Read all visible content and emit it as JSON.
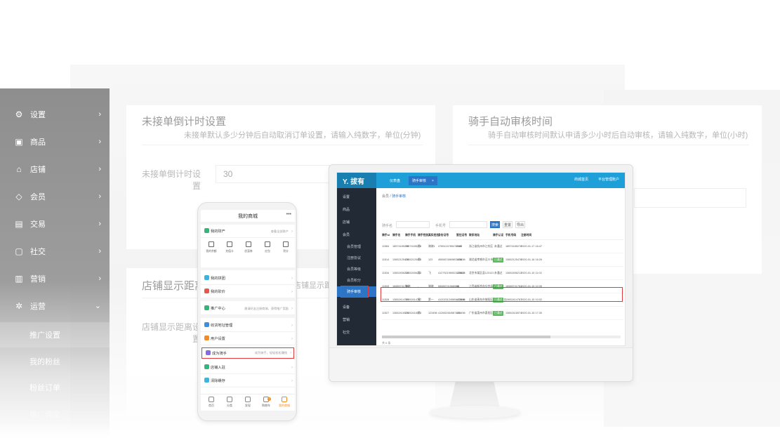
{
  "sidebar": {
    "items": [
      {
        "label": "设置",
        "icon": "gear-icon",
        "glyph": "⚙"
      },
      {
        "label": "商品",
        "icon": "cube-icon",
        "glyph": "▣"
      },
      {
        "label": "店铺",
        "icon": "store-icon",
        "glyph": "⌂"
      },
      {
        "label": "会员",
        "icon": "diamond-icon",
        "glyph": "◇"
      },
      {
        "label": "交易",
        "icon": "ledger-icon",
        "glyph": "▤"
      },
      {
        "label": "社交",
        "icon": "chat-icon",
        "glyph": "▢"
      },
      {
        "label": "营销",
        "icon": "bar-chart-icon",
        "glyph": "▥"
      },
      {
        "label": "运营",
        "icon": "settings-cog-icon",
        "glyph": "✲"
      }
    ],
    "sub_items": [
      "推广设置",
      "我的粉丝",
      "粉丝订单",
      "推广佣金"
    ],
    "active_sub": "推广设置"
  },
  "cards": {
    "countdown": {
      "title": "未接单倒计时设置",
      "desc": "未接单默认多少分钟后自动取消订单设置，请输入纯数字，单位(分钟)",
      "field_label": "未接单倒计时设置",
      "field_value": "30"
    },
    "distance": {
      "title": "店铺显示距离",
      "desc": "店铺显示距离，",
      "field_label": "店铺显示距离设置"
    },
    "rider": {
      "title": "骑手自动审核时间",
      "desc": "骑手自动审核时间默认申请多少小时后自动审核，请输入纯数字，单位(小时)"
    }
  },
  "admin_app": {
    "logo": "Y. 拔有",
    "tabs": [
      "仪表盘",
      "骑手审核"
    ],
    "tab_close": "×",
    "top_right": [
      "商城首页",
      "平台管理账户"
    ],
    "side": [
      "设置",
      "商品",
      "店铺",
      "会员"
    ],
    "side_sub": [
      "会员管理",
      "注册协议",
      "会员等级",
      "会员积分",
      "骑手审核"
    ],
    "side_more": [
      "设备",
      "营销",
      "社交"
    ],
    "breadcrumb_prefix": "会员 /",
    "breadcrumb_current": "骑手审核",
    "filter_labels": [
      "骑手名",
      "手机号"
    ],
    "buttons": [
      "搜索",
      "重置",
      "导出"
    ],
    "columns": [
      "骑手id",
      "骑手名",
      "骑手手机",
      "骑手性别",
      "真实姓名",
      "身份证号",
      "暂住证号",
      "联系地址",
      "骑手认证",
      "手机号码",
      "注册时间"
    ],
    "rows": [
      [
        "11584",
        "18574185278",
        "18574185278",
        "男",
        "骑骑1",
        "4785124785478585",
        "2143",
        "浙江省杭州市江东区",
        "未通过",
        "18574185278",
        "2020-01-17 16:47"
      ],
      [
        "11514",
        "13652125478",
        "13652125478",
        "男",
        "123",
        "4565874569857456",
        "123456",
        "湖北省孝感市汉川市123456",
        "已通过",
        "13652125478",
        "2020-01-16 16:26"
      ],
      [
        "11534",
        "13652456213",
        "13652456213",
        "男",
        "飞",
        "412752196502128812",
        "123456",
        "北京市某区县123121",
        "未通过",
        "13652456213",
        "2020-01-15 11:02"
      ],
      [
        "11533",
        "16585741784",
        "骑骑",
        "-",
        "骑骑",
        "56585741568568",
        "56",
        "江西省新余市分宜县xxx",
        "已通过",
        "16585741784",
        "2020-01-15 10:35"
      ],
      [
        "11528",
        "13652414787",
        "13652414787",
        "男",
        "第一",
        "412023124585412548",
        "123456",
        "山东省青岛市城阳区一二三四五",
        "已通过",
        "13652414787",
        "2020-01-15 10:02"
      ],
      [
        "11527",
        "13652416574",
        "13652416574",
        "男",
        "123456",
        "412652454587456",
        "123456",
        "广东省惠州市惠阳区中心",
        "已通过",
        "13652416574",
        "2020-01-15 17:30"
      ]
    ],
    "footer": "共 6 条"
  },
  "phone_app": {
    "title": "我的商城",
    "dots": "•••",
    "rows": {
      "assets": {
        "label": "我的财产",
        "right": "查看全部财产"
      },
      "groupbuy": {
        "label": "我的拼团"
      },
      "bargain": {
        "label": "我的砍价"
      },
      "promo": {
        "label": "推广中心",
        "right": "邀请好友注册商城，获得推广奖励"
      },
      "address": {
        "label": "收货地址管理"
      },
      "usersettings": {
        "label": "用户设置"
      },
      "rider": {
        "label": "成为骑手",
        "right": "成为骑手，轻轻松松赚钱"
      },
      "storein": {
        "label": "店铺入驻"
      },
      "clearcache": {
        "label": "清除缓存"
      }
    },
    "asset_icons": [
      "我的余额",
      "充值卡",
      "优惠券",
      "红包",
      "积分"
    ],
    "tabbar": [
      "首页",
      "分类",
      "发现",
      "购物车",
      "我的商城"
    ],
    "cart_count": "1"
  },
  "colors": {
    "accent": "#1e9fd8",
    "primary": "#2c75c6",
    "highlight": "#e23b3b",
    "success": "#5cb85c",
    "phone_accent": "#f08c28"
  }
}
